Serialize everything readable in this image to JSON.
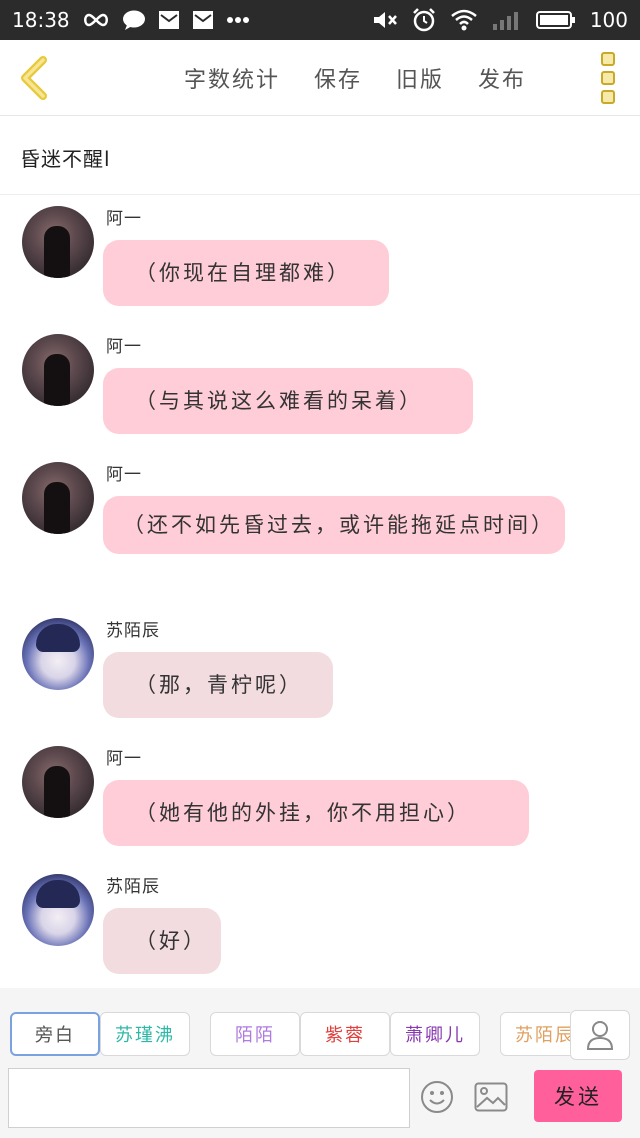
{
  "status_bar": {
    "time": "18:38",
    "battery": "100"
  },
  "toolbar": {
    "actions": [
      "字数统计",
      "保存",
      "旧版",
      "发布"
    ]
  },
  "story_title": "昏迷不醒l",
  "messages": [
    {
      "name": "阿一",
      "text": "（你现在自理都难）",
      "avatar": "dark",
      "style": "pink"
    },
    {
      "name": "阿一",
      "text": "（与其说这么难看的呆着）",
      "avatar": "dark",
      "style": "pink"
    },
    {
      "name": "阿一",
      "text": "（还不如先昏过去，或许能拖延点时间）",
      "avatar": "dark",
      "style": "pink"
    },
    {
      "name": "苏陌辰",
      "text": "（那，青柠呢）",
      "avatar": "anime",
      "style": "grey"
    },
    {
      "name": "阿一",
      "text": "（她有他的外挂，你不用担心）",
      "avatar": "dark",
      "style": "pink"
    },
    {
      "name": "苏陌辰",
      "text": "（好）",
      "avatar": "anime",
      "style": "grey"
    }
  ],
  "roles": [
    {
      "label": "旁白",
      "color": "#555555"
    },
    {
      "label": "苏瑾沸",
      "color": "#2fb8a8"
    },
    {
      "label": "陌陌",
      "color": "#b07be0"
    },
    {
      "label": "紫蓉",
      "color": "#e04040"
    },
    {
      "label": "萧卿儿",
      "color": "#8a3ab0"
    },
    {
      "label": "苏陌辰",
      "color": "#e0a060"
    }
  ],
  "input": {
    "value": "",
    "placeholder": ""
  },
  "send_label": "发送",
  "colors": {
    "bubble_pink": "#ffcdd8",
    "bubble_grey": "#f2dcdf",
    "send_button": "#ff5f9a",
    "accent_yellow": "#e8c93a"
  }
}
